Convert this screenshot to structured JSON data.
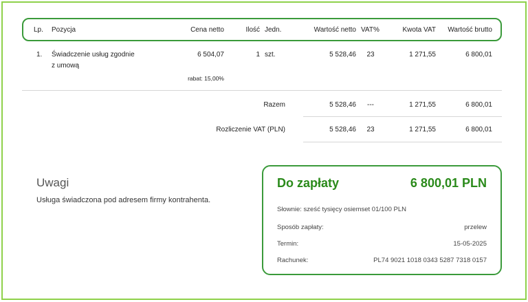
{
  "table": {
    "headers": {
      "lp": "Lp.",
      "pozycja": "Pozycja",
      "cena_netto": "Cena netto",
      "ilosc": "Ilość",
      "jedn": "Jedn.",
      "wartosc_netto": "Wartość netto",
      "vat_pct": "VAT%",
      "kwota_vat": "Kwota VAT",
      "wartosc_brutto": "Wartość brutto"
    },
    "rows": [
      {
        "lp": "1.",
        "pozycja_line1": "Świadczenie usług zgodnie",
        "pozycja_line2": "z umową",
        "cena_netto": "6 504,07",
        "rabat": "rabat: 15,00%",
        "ilosc": "1",
        "jedn": "szt.",
        "wartosc_netto": "5 528,46",
        "vat_pct": "23",
        "kwota_vat": "1 271,55",
        "wartosc_brutto": "6 800,01"
      }
    ],
    "razem": {
      "label": "Razem",
      "wartosc_netto": "5 528,46",
      "vat_pct": "---",
      "kwota_vat": "1 271,55",
      "wartosc_brutto": "6 800,01"
    },
    "rozliczenie": {
      "label": "Rozliczenie VAT (PLN)",
      "wartosc_netto": "5 528,46",
      "vat_pct": "23",
      "kwota_vat": "1 271,55",
      "wartosc_brutto": "6 800,01"
    }
  },
  "uwagi": {
    "title": "Uwagi",
    "text": "Usługa świadczona pod adresem firmy kontrahenta."
  },
  "payment": {
    "title": "Do zapłaty",
    "amount": "6 800,01 PLN",
    "slownie": "Słownie: sześć tysięcy osiemset 01/100 PLN",
    "sposob_label": "Sposób zapłaty:",
    "sposob_value": "przelew",
    "termin_label": "Termin:",
    "termin_value": "15-05-2025",
    "rachunek_label": "Rachunek:",
    "rachunek_value": "PL74 9021 1018 0343 5287 7318 0157"
  },
  "colors": {
    "frame": "#8ed14a",
    "accent": "#3a9a3a",
    "amount_text": "#2a8a1a"
  }
}
